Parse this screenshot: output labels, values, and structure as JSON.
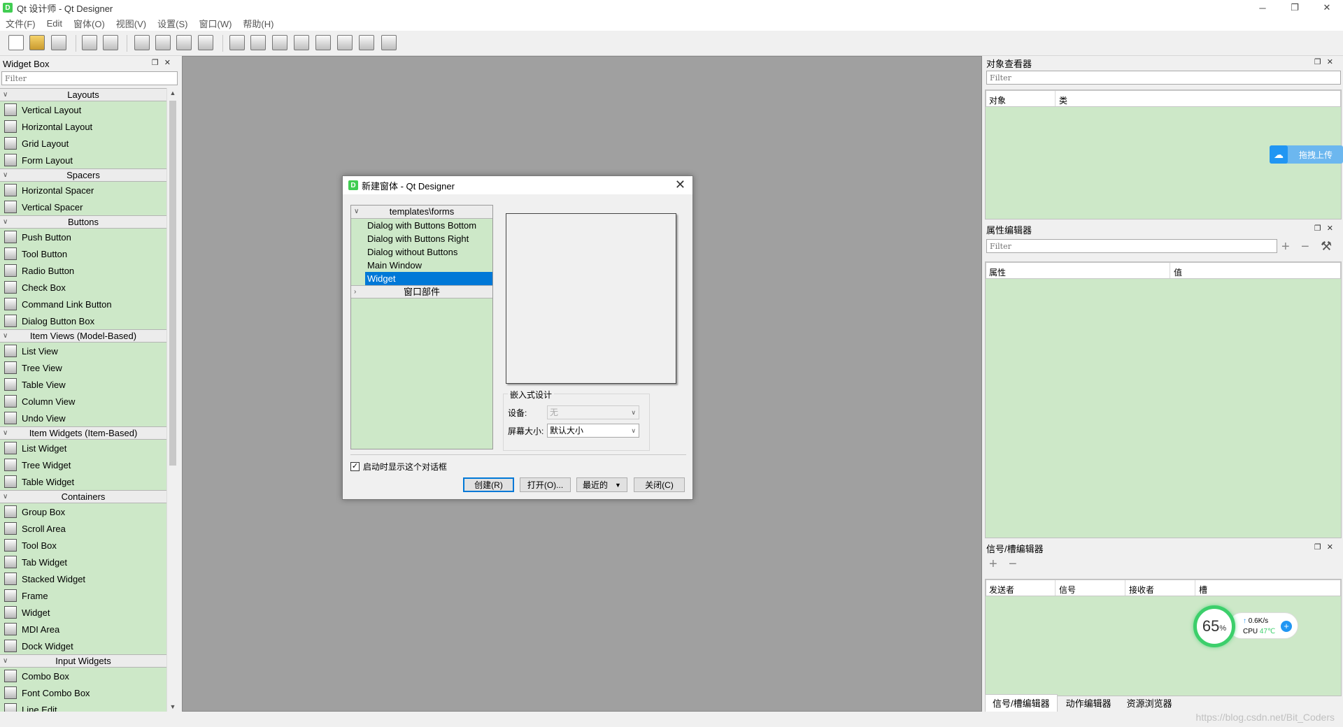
{
  "window": {
    "title": "Qt 设计师 - Qt Designer",
    "app_icon": "D",
    "min": "─",
    "max": "❐",
    "close": "✕"
  },
  "menubar": [
    "文件(F)",
    "Edit",
    "窗体(O)",
    "视图(V)",
    "设置(S)",
    "窗口(W)",
    "帮助(H)"
  ],
  "toolbar": [
    "new-form-icon",
    "open-form-icon",
    "save-form-icon",
    "bring-to-front-icon",
    "send-to-back-icon",
    "edit-widgets-icon",
    "edit-signals-slots-icon",
    "edit-buddies-icon",
    "edit-tab-order-icon",
    "lay-out-horizontally-icon",
    "lay-out-vertically-icon",
    "lay-out-horizontally-splitter-icon",
    "lay-out-vertically-splitter-icon",
    "lay-out-grid-icon",
    "lay-out-form-icon",
    "break-layout-icon",
    "adjust-size-icon"
  ],
  "widget_box": {
    "title": "Widget Box",
    "filter_placeholder": "Filter",
    "categories": [
      {
        "name": "Layouts",
        "items": [
          "Vertical Layout",
          "Horizontal Layout",
          "Grid Layout",
          "Form Layout"
        ]
      },
      {
        "name": "Spacers",
        "items": [
          "Horizontal Spacer",
          "Vertical Spacer"
        ]
      },
      {
        "name": "Buttons",
        "items": [
          "Push Button",
          "Tool Button",
          "Radio Button",
          "Check Box",
          "Command Link Button",
          "Dialog Button Box"
        ]
      },
      {
        "name": "Item Views (Model-Based)",
        "items": [
          "List View",
          "Tree View",
          "Table View",
          "Column View",
          "Undo View"
        ]
      },
      {
        "name": "Item Widgets (Item-Based)",
        "items": [
          "List Widget",
          "Tree Widget",
          "Table Widget"
        ]
      },
      {
        "name": "Containers",
        "items": [
          "Group Box",
          "Scroll Area",
          "Tool Box",
          "Tab Widget",
          "Stacked Widget",
          "Frame",
          "Widget",
          "MDI Area",
          "Dock Widget"
        ]
      },
      {
        "name": "Input Widgets",
        "items": [
          "Combo Box",
          "Font Combo Box",
          "Line Edit"
        ]
      }
    ]
  },
  "dialog": {
    "title": "新建窗体 - Qt Designer",
    "tree_header": "templates\\forms",
    "templates": [
      "Dialog with Buttons Bottom",
      "Dialog with Buttons Right",
      "Dialog without Buttons",
      "Main Window",
      "Widget"
    ],
    "selected": "Widget",
    "widgets_group": "窗口部件",
    "embedded": {
      "legend": "嵌入式设计",
      "device_label": "设备:",
      "device_value": "无",
      "screen_label": "屏幕大小:",
      "screen_value": "默认大小"
    },
    "show_on_startup": "启动时显示这个对话框",
    "show_on_startup_checked": true,
    "buttons": {
      "create": "创建(R)",
      "open": "打开(O)...",
      "recent": "最近的",
      "close": "关闭(C)"
    }
  },
  "object_inspector": {
    "title": "对象查看器",
    "filter_placeholder": "Filter",
    "col_object": "对象",
    "col_class": "类"
  },
  "property_editor": {
    "title": "属性编辑器",
    "filter_placeholder": "Filter",
    "col_property": "属性",
    "col_value": "值"
  },
  "signal_slot_editor": {
    "title": "信号/槽编辑器",
    "cols": [
      "发送者",
      "信号",
      "接收者",
      "槽"
    ]
  },
  "bottom_tabs": [
    "信号/槽编辑器",
    "动作编辑器",
    "资源浏览器"
  ],
  "overlay": {
    "upload_label": "拖拽上传",
    "cpu_percent": "65",
    "cpu_percent_unit": "%",
    "net_speed": "0.6K/s",
    "cpu_label": "CPU",
    "cpu_temp": "47℃"
  },
  "watermark": "https://blog.csdn.net/Bit_Coders"
}
